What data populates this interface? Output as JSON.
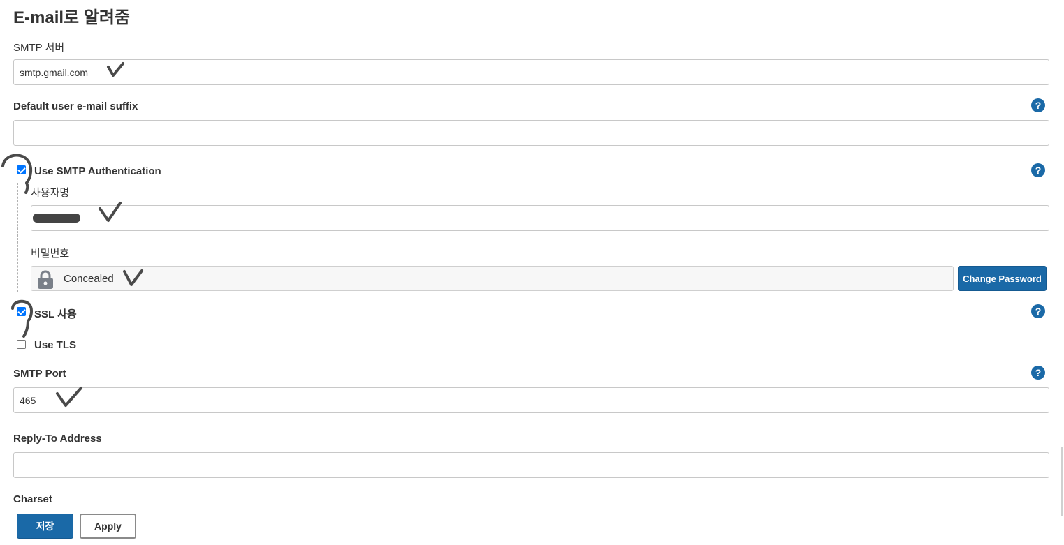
{
  "section": {
    "title": "E-mail로 알려줌"
  },
  "smtp_server": {
    "label": "SMTP 서버",
    "value": "smtp.gmail.com"
  },
  "default_suffix": {
    "label": "Default user e-mail suffix",
    "value": "",
    "help": "?"
  },
  "smtp_auth": {
    "label": "Use SMTP Authentication",
    "checked": true,
    "help": "?",
    "username": {
      "label": "사용자명",
      "value": ""
    },
    "password": {
      "label": "비밀번호",
      "concealed_text": "Concealed",
      "change_button": "Change Password"
    }
  },
  "ssl": {
    "label": "SSL 사용",
    "checked": true,
    "help": "?"
  },
  "tls": {
    "label": "Use TLS",
    "checked": false
  },
  "smtp_port": {
    "label": "SMTP Port",
    "value": "465",
    "help": "?"
  },
  "reply_to": {
    "label": "Reply-To Address",
    "value": ""
  },
  "charset": {
    "label": "Charset"
  },
  "buttons": {
    "save": "저장",
    "apply": "Apply"
  },
  "colors": {
    "primary": "#1a69a7",
    "checkbox": "#0075ff",
    "annotation": "#4a4a4a"
  }
}
